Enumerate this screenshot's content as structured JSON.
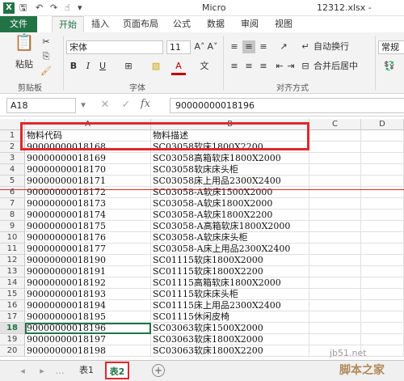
{
  "titlebar": {
    "app_title": "Micro",
    "file_title": "12312.xlsx -"
  },
  "ribbon_tabs": [
    "文件",
    "开始",
    "插入",
    "页面布局",
    "公式",
    "数据",
    "审阅",
    "视图"
  ],
  "ribbon": {
    "paste_label": "粘贴",
    "font_name": "宋体",
    "font_size": "11",
    "wrap_text": "自动换行",
    "merge_center": "合并后居中",
    "number_format": "常规",
    "groups": {
      "clipboard": "剪贴板",
      "font": "字体",
      "alignment": "对齐方式"
    }
  },
  "formula_bar": {
    "name_box": "A18",
    "value": "90000000018196",
    "fx": "fx"
  },
  "grid": {
    "columns": [
      "A",
      "B",
      "C",
      "D"
    ],
    "rows": [
      {
        "n": "1",
        "a": "物料代码",
        "b": "物料描述"
      },
      {
        "n": "2",
        "a": "90000000018168",
        "b": "SC03058软床1800X2200"
      },
      {
        "n": "3",
        "a": "90000000018169",
        "b": "SC03058高箱软床1800X2000"
      },
      {
        "n": "4",
        "a": "90000000018170",
        "b": "SC03058软床床头柜"
      },
      {
        "n": "5",
        "a": "90000000018171",
        "b": "SC03058床上用品2300X2400"
      },
      {
        "n": "6",
        "a": "90000000018172",
        "b": "SC03058-A软床1500X2000"
      },
      {
        "n": "7",
        "a": "90000000018173",
        "b": "SC03058-A软床1800X2000"
      },
      {
        "n": "8",
        "a": "90000000018174",
        "b": "SC03058-A软床1800X2200"
      },
      {
        "n": "9",
        "a": "90000000018175",
        "b": "SC03058-A高箱软床1800X2000"
      },
      {
        "n": "10",
        "a": "90000000018176",
        "b": "SC03058-A软床床头柜"
      },
      {
        "n": "11",
        "a": "90000000018177",
        "b": "SC03058-A床上用品2300X2400"
      },
      {
        "n": "12",
        "a": "90000000018190",
        "b": "SC01115软床1800X2000"
      },
      {
        "n": "13",
        "a": "90000000018191",
        "b": "SC01115软床1800X2200"
      },
      {
        "n": "14",
        "a": "90000000018192",
        "b": "SC01115高箱软床1800X2000"
      },
      {
        "n": "15",
        "a": "90000000018193",
        "b": "SC01115软床床头柜"
      },
      {
        "n": "16",
        "a": "90000000018194",
        "b": "SC01115床上用品2300X2400"
      },
      {
        "n": "17",
        "a": "90000000018195",
        "b": "SC01115休闲皮椅"
      },
      {
        "n": "18",
        "a": "90000000018196",
        "b": "SC03063软床1500X2000"
      },
      {
        "n": "19",
        "a": "90000000018197",
        "b": "SC03063软床1800X2000"
      },
      {
        "n": "20",
        "a": "90000000018198",
        "b": "SC03063软床1800X2200"
      }
    ]
  },
  "sheets": [
    "表1",
    "表2"
  ],
  "watermark": {
    "domain": "jb51.net",
    "name": "脚本之家"
  },
  "colors": {
    "accent": "#217346",
    "highlight": "#e0282e"
  }
}
